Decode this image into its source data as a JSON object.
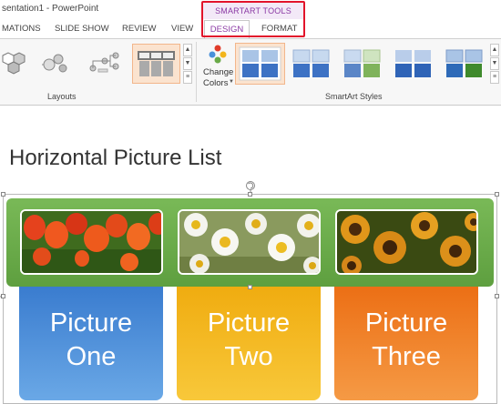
{
  "titlebar": {
    "text": "sentation1 - PowerPoint"
  },
  "tabs": {
    "animations": "MATIONS",
    "slideshow": "SLIDE SHOW",
    "review": "REVIEW",
    "view": "VIEW",
    "design": "DESIGN",
    "format": "FORMAT"
  },
  "context_header": "SMARTART TOOLS",
  "ribbon": {
    "layouts_label": "Layouts",
    "change_colors_line1": "Change",
    "change_colors_line2": "Colors",
    "smartart_styles_label": "SmartArt Styles"
  },
  "slide": {
    "title": "Horizontal Picture List",
    "cards": [
      {
        "line1": "Picture",
        "line2": "One",
        "color": "#4a90d9"
      },
      {
        "line1": "Picture",
        "line2": "Two",
        "color": "#f2b51c"
      },
      {
        "line1": "Picture",
        "line2": "Three",
        "color": "#ef7b23"
      }
    ],
    "banner_color": "#6aaa48"
  },
  "icons": [
    "dropdown-arrow-icon",
    "scroll-up-icon",
    "scroll-down-icon",
    "more-icon",
    "rotate-handle-icon"
  ]
}
